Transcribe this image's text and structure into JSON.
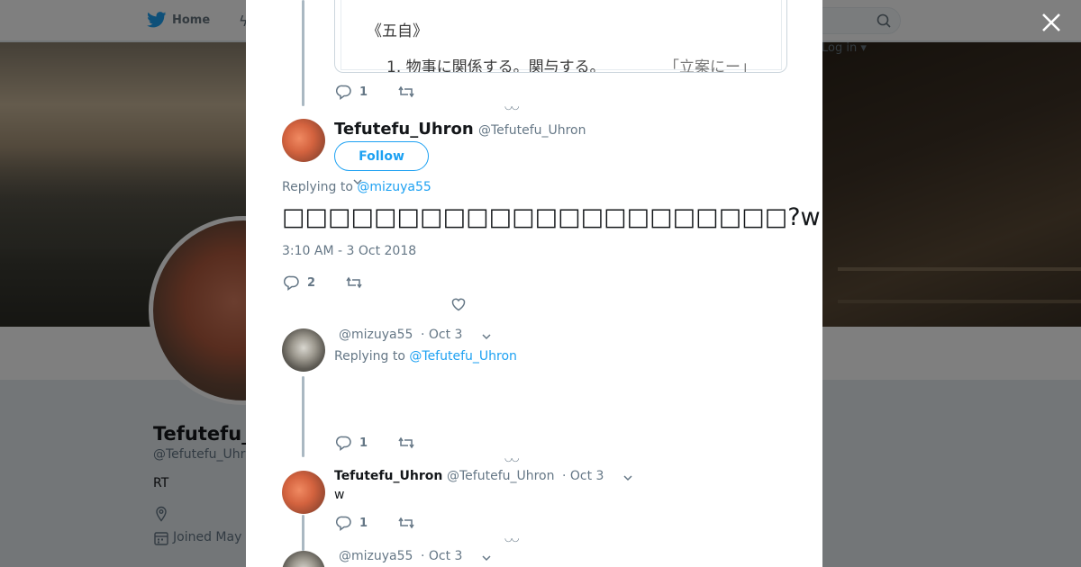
{
  "nav": {
    "home_label": "Home",
    "login_label": "Log in ▾"
  },
  "profile": {
    "name": "Tefutefu_",
    "handle": "@Tefutefu_Uhr",
    "bio": "RT",
    "joined": "Joined May"
  },
  "thread": {
    "embed_card": {
      "title": "《五自》",
      "definition": "1.  物事に関係する。関与する。",
      "example": "「立案にー」"
    },
    "first_actions": {
      "reply_count": "1"
    },
    "main_tweet": {
      "name": "Tefutefu_Uhron",
      "handle": "@Tefutefu_Uhron",
      "follow_label": "Follow",
      "replying_prefix": "Replying to",
      "replying_handle": "@mizuya55",
      "text": "□□□□□□□□□□□□□□□□□□□□□□?w",
      "timestamp": "3:10 AM - 3 Oct 2018",
      "reply_count": "2"
    },
    "reply1": {
      "handle": "@mizuya55",
      "date": "· Oct 3",
      "replying_prefix": "Replying to",
      "replying_handle": "@Tefutefu_Uhron",
      "reply_count": "1"
    },
    "reply2": {
      "name": "Tefutefu_Uhron",
      "handle": "@Tefutefu_Uhron",
      "date": "· Oct 3",
      "text": "w",
      "reply_count": "1"
    },
    "reply3": {
      "handle": "@mizuya55",
      "date": "· Oct 3"
    }
  },
  "colors": {
    "accent": "#1da1f2",
    "muted": "#657786",
    "thread_line": "#aab8c2"
  }
}
